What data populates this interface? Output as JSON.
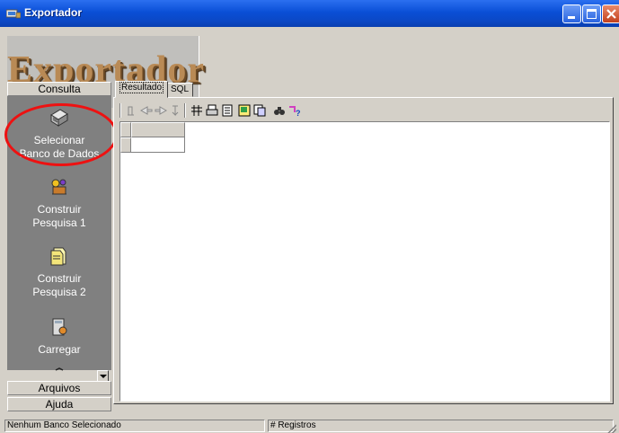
{
  "window": {
    "title": "Exportador"
  },
  "logo": {
    "text": "Exportador"
  },
  "sidebar": {
    "sections": [
      {
        "label": "Consulta"
      },
      {
        "label": "Arquivos"
      },
      {
        "label": "Ajuda"
      }
    ],
    "items": [
      {
        "label_line1": "Selecionar",
        "label_line2": "Banco de Dados",
        "icon": "database-icon",
        "highlighted": true
      },
      {
        "label_line1": "Construir",
        "label_line2": "Pesquisa 1",
        "icon": "query-builder-icon"
      },
      {
        "label_line1": "Construir",
        "label_line2": "Pesquisa 2",
        "icon": "query-wizard-icon"
      },
      {
        "label_line1": "Carregar",
        "label_line2": "",
        "icon": "load-icon"
      }
    ]
  },
  "tabs": [
    {
      "label": "Resultado",
      "active": true
    },
    {
      "label": "SQL",
      "active": false
    }
  ],
  "toolbar": {
    "icons": [
      "first-record-icon",
      "prev-record-icon",
      "next-record-icon",
      "last-record-icon",
      "grid-icon",
      "print-icon",
      "print-preview-icon",
      "export-icon",
      "copy-icon",
      "find-icon",
      "help-icon"
    ]
  },
  "statusbar": {
    "left": "Nenhum Banco Selecionado",
    "middle": "# Registros"
  },
  "colors": {
    "titlebar": "#0a4fd6",
    "sidebar_body": "#808080",
    "highlight_ring": "#e11111",
    "logo": "#b98a55"
  }
}
